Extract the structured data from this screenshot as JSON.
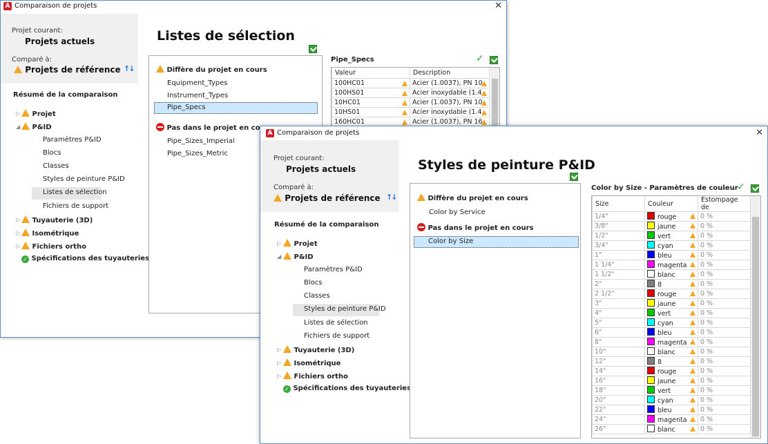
{
  "back": {
    "title": "Comparaison de projets",
    "close": "✕",
    "current_label": "Projet courant:",
    "current_name": "Projets actuels",
    "compared_label": "Comparé à:",
    "compared_name": "Projets de référence",
    "summary": "Résumé de la comparaison",
    "tree": {
      "projet": "Projet",
      "pid": "P&ID",
      "pid_children": [
        "Paramètres P&ID",
        "Blocs",
        "Classes",
        "Styles de peinture P&ID",
        "Listes de sélection",
        "Fichiers de support"
      ],
      "tuyau": "Tuyauterie (3D)",
      "iso": "Isométrique",
      "ortho": "Fichiers ortho",
      "specs": "Spécifications des tuyauteries"
    },
    "heading": "Listes de sélection",
    "diff_header": "Diffère du projet en cours",
    "diff_items": [
      "Equipment_Types",
      "Instrument_Types",
      "Pipe_Specs"
    ],
    "missing_header": "Pas dans le projet en cours",
    "missing_items": [
      "Pipe_Sizes_Imperial",
      "Pipe_Sizes_Metric"
    ],
    "grid_title": "Pipe_Specs",
    "columns": [
      "Valeur",
      "Description"
    ],
    "rows": [
      {
        "v": "100HC01",
        "d": "Acier (1.0037), PN 10"
      },
      {
        "v": "100HS01",
        "d": "Acier inoxydable (1.4"
      },
      {
        "v": "10HC01",
        "d": "Acier (1.0037), PN 10"
      },
      {
        "v": "10HS01",
        "d": "Acier inoxydable (1.4"
      },
      {
        "v": "160HC01",
        "d": "Acier (1.0037), PN 16"
      }
    ]
  },
  "front": {
    "title": "Comparaison de projets",
    "close": "✕",
    "current_label": "Projet courant:",
    "current_name": "Projets actuels",
    "compared_label": "Comparé à:",
    "compared_name": "Projets de référence",
    "summary": "Résumé de la comparaison",
    "tree": {
      "projet": "Projet",
      "pid": "P&ID",
      "pid_children": [
        "Paramètres P&ID",
        "Blocs",
        "Classes",
        "Styles de peinture P&ID",
        "Listes de sélection",
        "Fichiers de support"
      ],
      "tuyau": "Tuyauterie (3D)",
      "iso": "Isométrique",
      "ortho": "Fichiers ortho",
      "specs": "Spécifications des tuyauteries"
    },
    "heading": "Styles de peinture P&ID",
    "diff_header": "Diffère du projet en cours",
    "diff_items": [
      "Color by Service"
    ],
    "missing_header": "Pas dans le projet en cours",
    "missing_items": [
      "Color by Size"
    ],
    "grid_title": "Color by Size  - Paramètres de couleur",
    "columns": [
      "Size",
      "Couleur",
      "Estompage de"
    ],
    "rows": [
      {
        "size": "1/4\"",
        "color": "rouge",
        "hex": "#e00000",
        "fade": "0 %"
      },
      {
        "size": "3/8\"",
        "color": "jaune",
        "hex": "#ffff00",
        "fade": "0 %"
      },
      {
        "size": "1/2\"",
        "color": "vert",
        "hex": "#00cc00",
        "fade": "0 %"
      },
      {
        "size": "3/4\"",
        "color": "cyan",
        "hex": "#00ffff",
        "fade": "0 %"
      },
      {
        "size": "1\"",
        "color": "bleu",
        "hex": "#0000ff",
        "fade": "0 %"
      },
      {
        "size": "1 1/4\"",
        "color": "magenta",
        "hex": "#ff00ff",
        "fade": "0 %"
      },
      {
        "size": "1 1/2\"",
        "color": "blanc",
        "hex": "#ffffff",
        "fade": "0 %"
      },
      {
        "size": "2\"",
        "color": "8",
        "hex": "#808080",
        "fade": "0 %"
      },
      {
        "size": "2 1/2\"",
        "color": "rouge",
        "hex": "#e00000",
        "fade": "0 %"
      },
      {
        "size": "3\"",
        "color": "jaune",
        "hex": "#ffff00",
        "fade": "0 %"
      },
      {
        "size": "4\"",
        "color": "vert",
        "hex": "#00cc00",
        "fade": "0 %"
      },
      {
        "size": "5\"",
        "color": "cyan",
        "hex": "#00ffff",
        "fade": "0 %"
      },
      {
        "size": "6\"",
        "color": "bleu",
        "hex": "#0000ff",
        "fade": "0 %"
      },
      {
        "size": "8\"",
        "color": "magenta",
        "hex": "#ff00ff",
        "fade": "0 %"
      },
      {
        "size": "10\"",
        "color": "blanc",
        "hex": "#ffffff",
        "fade": "0 %"
      },
      {
        "size": "12\"",
        "color": "8",
        "hex": "#808080",
        "fade": "0 %"
      },
      {
        "size": "14\"",
        "color": "rouge",
        "hex": "#e00000",
        "fade": "0 %"
      },
      {
        "size": "16\"",
        "color": "jaune",
        "hex": "#ffff00",
        "fade": "0 %"
      },
      {
        "size": "18\"",
        "color": "vert",
        "hex": "#00cc00",
        "fade": "0 %"
      },
      {
        "size": "20\"",
        "color": "cyan",
        "hex": "#00ffff",
        "fade": "0 %"
      },
      {
        "size": "22\"",
        "color": "bleu",
        "hex": "#0000ff",
        "fade": "0 %"
      },
      {
        "size": "24\"",
        "color": "magenta",
        "hex": "#ff00ff",
        "fade": "0 %"
      },
      {
        "size": "26\"",
        "color": "blanc",
        "hex": "#ffffff",
        "fade": "0 %"
      }
    ]
  },
  "icons": {
    "warning": "warning-icon",
    "ok": "check-circle-icon",
    "missing": "no-entry-icon",
    "sort": "sort-arrows-icon",
    "accept": "checkmark-icon",
    "accept_all": "accept-all-icon"
  }
}
